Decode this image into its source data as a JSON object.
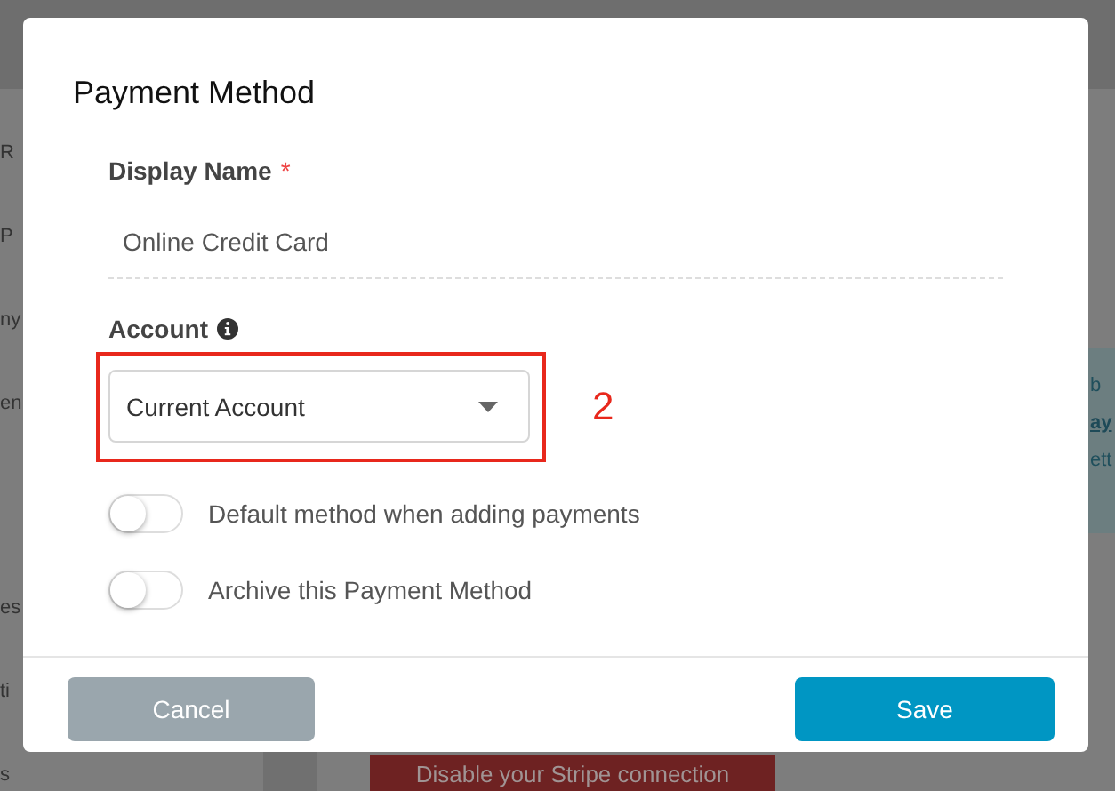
{
  "background": {
    "sidebar_items": [
      "R",
      "P",
      "ny",
      "en",
      "es",
      "ti",
      "s"
    ],
    "notice_lines": [
      {
        "kind": "text",
        "text": "b"
      },
      {
        "kind": "link",
        "text": "ay"
      },
      {
        "kind": "text",
        "text": "ett"
      }
    ],
    "stripe_button": "Disable your Stripe connection"
  },
  "dialog": {
    "title": "Payment Method",
    "fields": [
      {
        "kind": "text",
        "label": "Display Name",
        "required_mark": "*",
        "value": "Online Credit Card"
      },
      {
        "kind": "select",
        "label": "Account",
        "info": true,
        "value": "Current Account",
        "annotation": "2"
      }
    ],
    "toggles": [
      {
        "label": "Default method when adding payments",
        "on": false
      },
      {
        "label": "Archive this Payment Method",
        "on": false
      }
    ],
    "buttons": [
      {
        "kind": "cancel",
        "label": "Cancel"
      },
      {
        "kind": "save",
        "label": "Save"
      }
    ]
  }
}
